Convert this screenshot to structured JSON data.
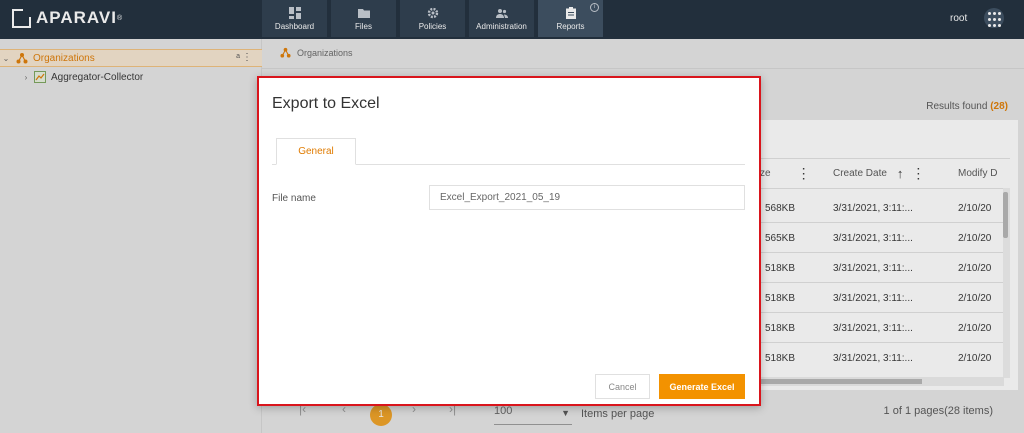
{
  "app": {
    "logo_text": "APARAVI",
    "logo_reg": "®",
    "user": "root"
  },
  "nav": {
    "tabs": [
      {
        "label": "Dashboard",
        "icon": "dashboard-icon"
      },
      {
        "label": "Files",
        "icon": "folder-icon"
      },
      {
        "label": "Policies",
        "icon": "gear-icon"
      },
      {
        "label": "Administration",
        "icon": "users-icon"
      },
      {
        "label": "Reports",
        "icon": "clipboard-icon",
        "active": true
      }
    ],
    "info_badge": "i"
  },
  "sidebar": {
    "items": [
      {
        "label": "Organizations",
        "selected": true,
        "tag": "a"
      },
      {
        "label": "Aggregator-Collector",
        "selected": false
      }
    ]
  },
  "breadcrumb": "Organizations",
  "results": {
    "label": "Results found",
    "count": "(28)"
  },
  "table": {
    "columns": [
      "ze",
      "Create Date",
      "Modify D"
    ],
    "rows": [
      {
        "size": "568KB",
        "create": "3/31/2021, 3:11:...",
        "modify": "2/10/20"
      },
      {
        "size": "565KB",
        "create": "3/31/2021, 3:11:...",
        "modify": "2/10/20"
      },
      {
        "size": "518KB",
        "create": "3/31/2021, 3:11:...",
        "modify": "2/10/20"
      },
      {
        "size": "518KB",
        "create": "3/31/2021, 3:11:...",
        "modify": "2/10/20"
      },
      {
        "size": "518KB",
        "create": "3/31/2021, 3:11:...",
        "modify": "2/10/20"
      },
      {
        "size": "518KB",
        "create": "3/31/2021, 3:11:...",
        "modify": "2/10/20"
      }
    ]
  },
  "pagination": {
    "first": "|‹",
    "prev": "‹",
    "current": "1",
    "next": "›",
    "last": "›|",
    "per_page": "100",
    "per_page_label": "Items per page",
    "summary": "1 of 1 pages(28 items)"
  },
  "modal": {
    "title": "Export to Excel",
    "tab": "General",
    "field_label": "File name",
    "field_value": "Excel_Export_2021_05_19",
    "cancel": "Cancel",
    "generate": "Generate Excel"
  },
  "colors": {
    "topbar": "#1c2b3a",
    "accent": "#f39200",
    "highlight_border": "#d9151c"
  }
}
